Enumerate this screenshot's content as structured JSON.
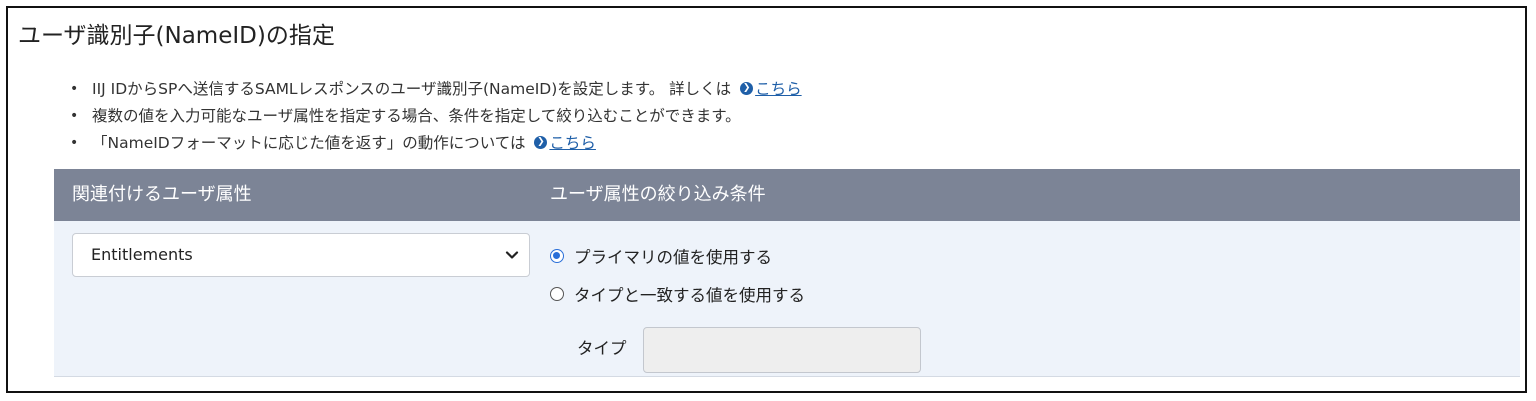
{
  "page_title": "ユーザ識別子(NameID)の指定",
  "notes": [
    {
      "text": "IIJ IDからSPへ送信するSAMLレスポンスのユーザ識別子(NameID)を設定します。 詳しくは",
      "link": "こちら"
    },
    {
      "text": "複数の値を入力可能なユーザ属性を指定する場合、条件を指定して絞り込むことができます。",
      "link": ""
    },
    {
      "text": "「NameIDフォーマットに応じた値を返す」の動作については",
      "link": "こちら"
    }
  ],
  "bullet": "•",
  "table": {
    "headers": {
      "attribute": "関連付けるユーザ属性",
      "condition": "ユーザ属性の絞り込み条件"
    },
    "attribute_select": {
      "selected": "Entitlements",
      "icon": "chevron-down-icon"
    },
    "condition_options": [
      {
        "label": "プライマリの値を使用する",
        "checked": true
      },
      {
        "label": "タイプと一致する値を使用する",
        "checked": false
      }
    ],
    "type_field": {
      "label": "タイプ",
      "value": ""
    }
  },
  "colors": {
    "header_bg": "#7c8496",
    "row_bg": "#eef3fa",
    "link": "#1f5fa8",
    "radio_accent": "#2a6fd8"
  }
}
